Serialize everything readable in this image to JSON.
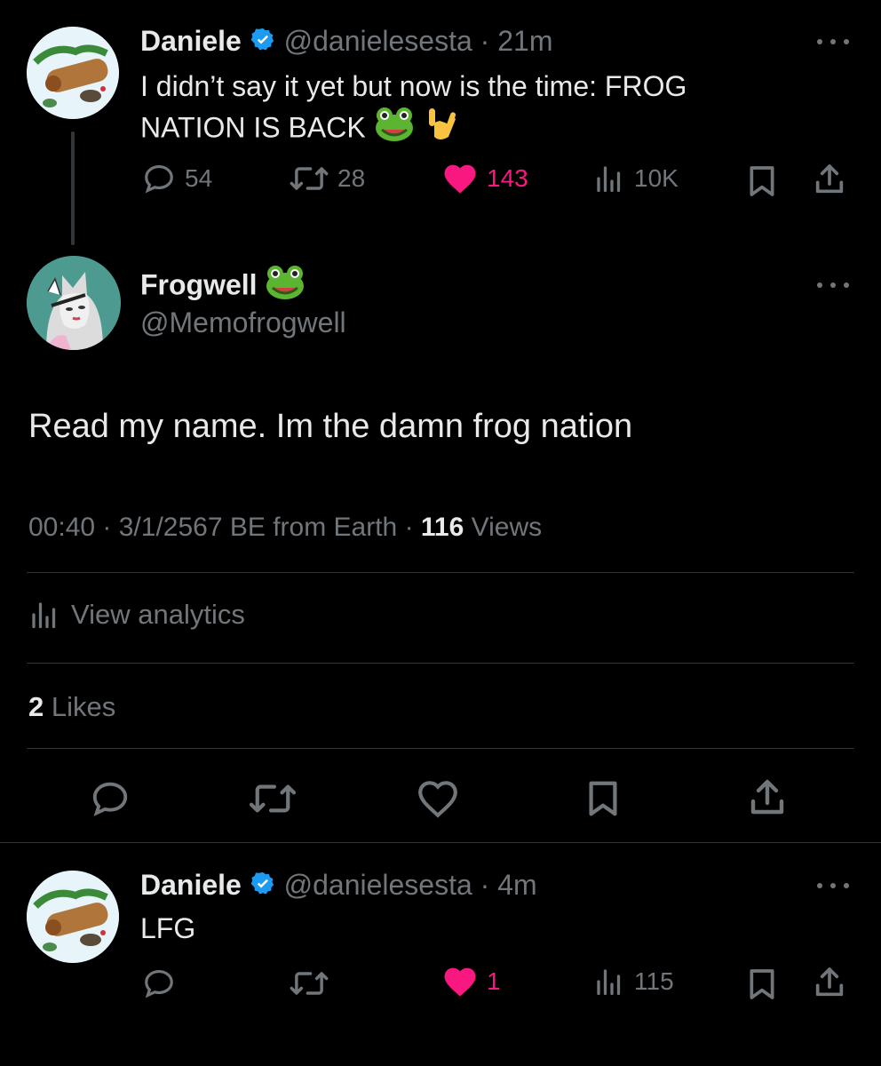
{
  "tweet1": {
    "display_name": "Daniele",
    "handle": "@danielesesta",
    "dot": "·",
    "time": "21m",
    "text_line1": "I didn’t say it yet but now is the time: FROG",
    "text_line2": "NATION IS BACK",
    "replies": "54",
    "retweets": "28",
    "likes": "143",
    "views": "10K"
  },
  "main": {
    "display_name": "Frogwell",
    "handle": "@Memofrogwell",
    "text": "Read my name. Im the damn frog nation",
    "timestamp": "00:40 · 3/1/2567 BE from Earth · ",
    "views_count": "116",
    "views_label": " Views",
    "analytics_label": "View analytics",
    "likes_count": "2",
    "likes_label": " Likes"
  },
  "tweet2": {
    "display_name": "Daniele",
    "handle": "@danielesesta",
    "dot": "·",
    "time": "4m",
    "text": "LFG",
    "likes": "1",
    "views": "115"
  },
  "colors": {
    "background": "#000000",
    "text": "#e7e9ea",
    "muted": "#71767b",
    "like_pink": "#f91880",
    "verified_blue": "#1d9bf0",
    "divider": "#2f3336"
  }
}
